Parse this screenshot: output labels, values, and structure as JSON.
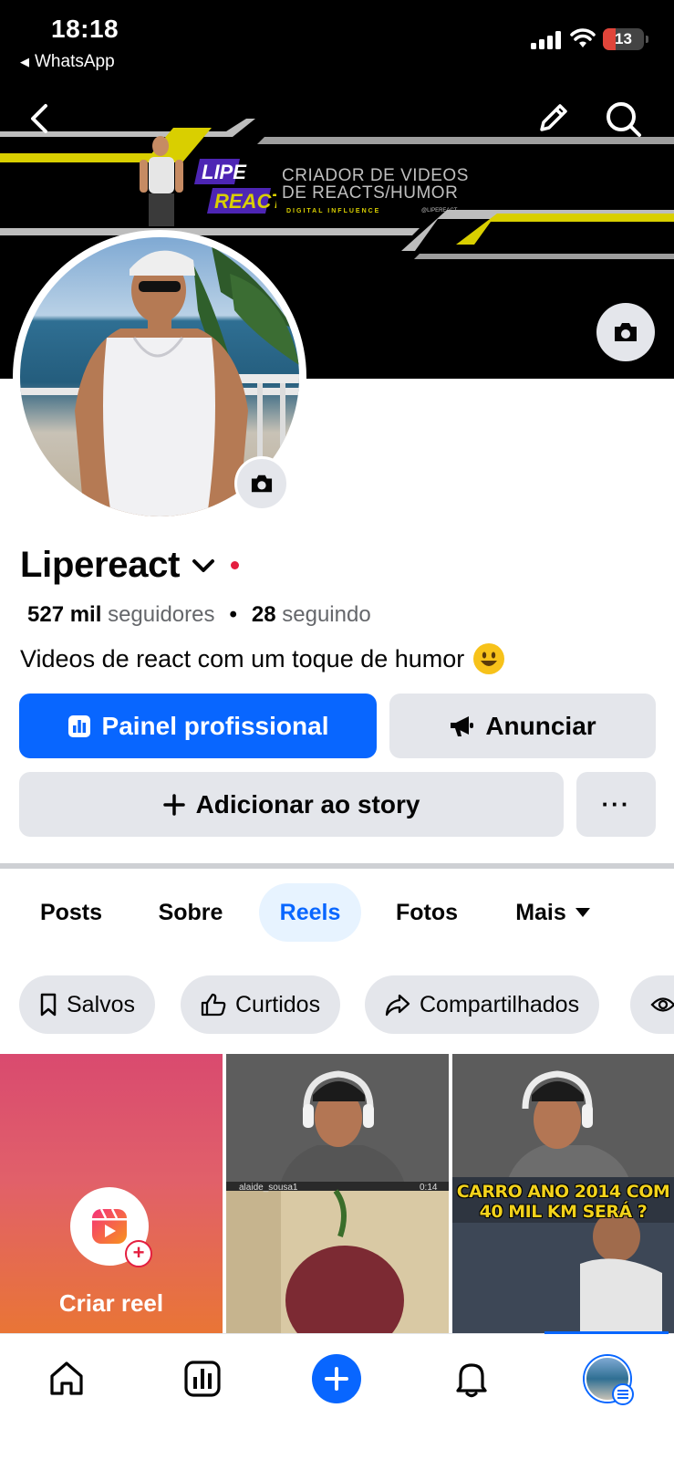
{
  "status_bar": {
    "time": "18:18",
    "back_app": "WhatsApp",
    "battery": "13",
    "battery_color": "#e0453a"
  },
  "header": {
    "back_icon": "chevron-left-icon",
    "edit_icon": "pencil-icon",
    "search_icon": "search-icon"
  },
  "cover": {
    "logo_line1": "LIPE",
    "logo_line2": "REACT",
    "title": "CRIADOR DE VIDEOS DE REACTS/HUMOR",
    "subtitle": "DIGITAL INFLUENCE",
    "handle": "@LIPEREACT",
    "camera_icon": "camera-icon",
    "accent_color": "#d9cf00"
  },
  "profile": {
    "name": "Lipereact",
    "followers_count": "527 mil",
    "followers_label": "seguidores",
    "following_count": "28",
    "following_label": "seguindo",
    "bio": "Videos de react com um toque de humor",
    "bio_emoji": "smiling-face-icon"
  },
  "actions": {
    "dashboard_label": "Painel profissional",
    "advertise_label": "Anunciar",
    "add_story_label": "Adicionar ao story",
    "more_label": "···",
    "primary_color": "#0866ff"
  },
  "tabs": [
    {
      "label": "Posts",
      "active": false
    },
    {
      "label": "Sobre",
      "active": false
    },
    {
      "label": "Reels",
      "active": true
    },
    {
      "label": "Fotos",
      "active": false
    },
    {
      "label": "Mais",
      "active": false
    }
  ],
  "filters": [
    {
      "label": "Salvos",
      "icon": "bookmark-icon"
    },
    {
      "label": "Curtidos",
      "icon": "thumbs-up-icon"
    },
    {
      "label": "Compartilhados",
      "icon": "share-icon"
    },
    {
      "label": "",
      "icon": "eye-icon"
    }
  ],
  "grid": {
    "create_label": "Criar reel",
    "thumb1_caption": "alaide_sousa1",
    "thumb1_time": "0:14",
    "thumb2_overlay": "CARRO ANO 2014 COM 40 MIL KM SERÁ ?"
  },
  "bottom_nav": [
    {
      "icon": "home-icon"
    },
    {
      "icon": "dashboard-icon"
    },
    {
      "icon": "plus-icon"
    },
    {
      "icon": "bell-icon"
    },
    {
      "icon": "profile-avatar"
    }
  ]
}
